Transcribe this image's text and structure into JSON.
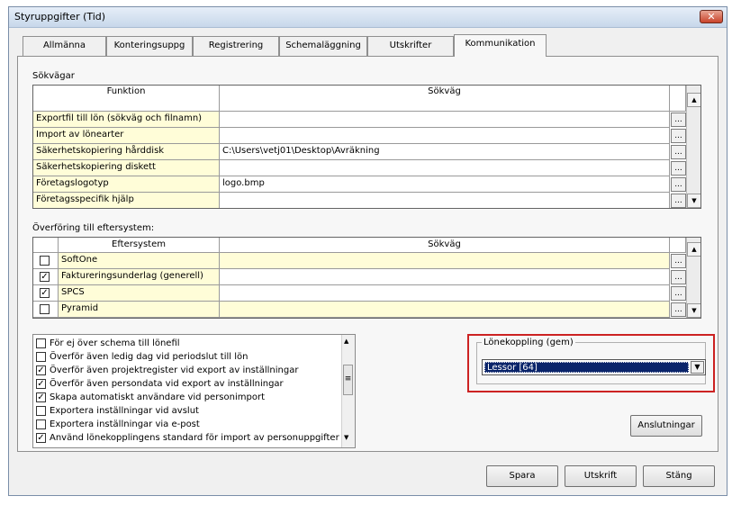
{
  "window": {
    "title": "Styruppgifter (Tid)",
    "close_glyph": "✕"
  },
  "tabs": [
    {
      "label": "Allmänna"
    },
    {
      "label": "Konteringsuppg"
    },
    {
      "label": "Registrering"
    },
    {
      "label": "Schemaläggning"
    },
    {
      "label": "Utskrifter"
    },
    {
      "label": "Kommunikation",
      "active": true
    }
  ],
  "paths": {
    "section_label": "Sökvägar",
    "col_function": "Funktion",
    "col_path": "Sökväg",
    "browse_label": "...",
    "rows": [
      {
        "function": "Exportfil till lön (sökväg och filnamn)",
        "path": ""
      },
      {
        "function": "Import av lönearter",
        "path": ""
      },
      {
        "function": "Säkerhetskopiering hårddisk",
        "path": "C:\\Users\\vetj01\\Desktop\\Avräkning"
      },
      {
        "function": "Säkerhetskopiering diskett",
        "path": ""
      },
      {
        "function": "Företagslogotyp",
        "path": "logo.bmp"
      },
      {
        "function": "Företagsspecifik hjälp",
        "path": ""
      }
    ]
  },
  "transfer": {
    "section_label": "Överföring till eftersystem:",
    "col_system": "Eftersystem",
    "col_path": "Sökväg",
    "rows": [
      {
        "system": "SoftOne",
        "checked": false,
        "path": ""
      },
      {
        "system": "Faktureringsunderlag (generell)",
        "checked": true,
        "path": ""
      },
      {
        "system": "SPCS",
        "checked": true,
        "path": ""
      },
      {
        "system": "Pyramid",
        "checked": false,
        "path": ""
      }
    ]
  },
  "options": [
    {
      "label": "För ej över schema till lönefil",
      "checked": false
    },
    {
      "label": "Överför även ledig dag vid periodslut till lön",
      "checked": false
    },
    {
      "label": "Överför även projektregister vid export av inställningar",
      "checked": true
    },
    {
      "label": "Överför även persondata vid export av inställningar",
      "checked": true
    },
    {
      "label": "Skapa automatiskt användare vid personimport",
      "checked": true
    },
    {
      "label": "Exportera inställningar vid avslut",
      "checked": false
    },
    {
      "label": "Exportera inställningar via e-post",
      "checked": false
    },
    {
      "label": "Använd lönekopplingens standard för import av personuppgifter",
      "checked": true
    }
  ],
  "payroll_link": {
    "legend": "Lönekoppling (gem)",
    "selected": "Lessor [64]"
  },
  "buttons": {
    "connections": "Anslutningar",
    "save": "Spara",
    "print": "Utskrift",
    "close": "Stäng"
  },
  "icons": {
    "check": "✓",
    "up_arrow": "▲",
    "down_arrow": "▼",
    "grip": "≡"
  }
}
